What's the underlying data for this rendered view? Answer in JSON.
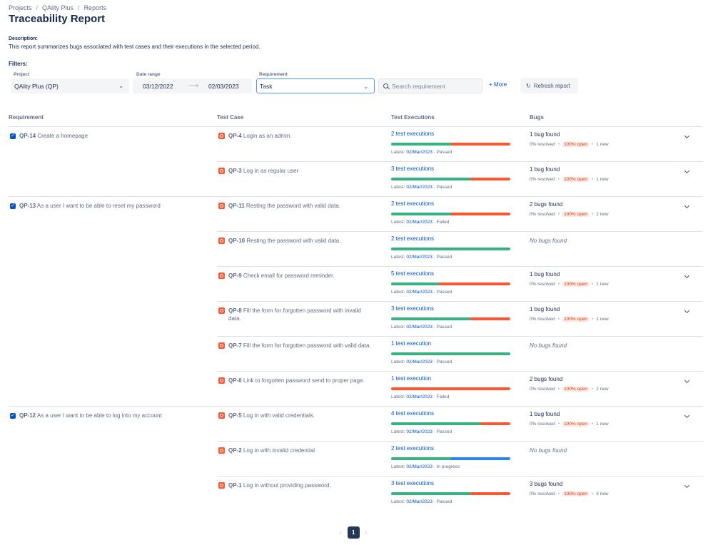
{
  "breadcrumbs": [
    "Projects",
    "QAlity Plus",
    "Reports"
  ],
  "title": "Traceability Report",
  "description_label": "Description:",
  "description": "This report summarizes bugs associated with test cases and their executions in the selected period.",
  "filters": {
    "label": "Filters:",
    "project_label": "Project",
    "project_value": "QAlity Plus (QP)",
    "date_label": "Date range",
    "date_from": "03/12/2022",
    "date_to": "02/03/2023",
    "requirement_label": "Requirement",
    "requirement_value": "Task",
    "search_placeholder": "Search requirement",
    "more_label": "More",
    "refresh_label": "Refresh report"
  },
  "columns": [
    "Requirement",
    "Test Case",
    "Test Executions",
    "Bugs"
  ],
  "colors": {
    "passed": "#36b37e",
    "failed": "#ff5630",
    "in_progress": "#2684ff"
  },
  "requirements": [
    {
      "key": "QP-14",
      "title": "Create a homepage"
    },
    {
      "key": "QP-13",
      "title": "As a user I want to be able to reset my password"
    },
    {
      "key": "QP-12",
      "title": "As a user I want to be able to log into my account"
    }
  ],
  "rows": [
    {
      "key": "QP-4",
      "title": "Login as an admin.",
      "executions": "2 test executions",
      "latest_label": "Latest:",
      "latest_date": "02/Mar/2023",
      "latest_status": "Passed",
      "bar": [
        [
          "passed",
          0.5
        ],
        [
          "failed",
          0.5
        ]
      ],
      "bugs": "1 bug found",
      "resolved": "0% resolved",
      "open": "100% open",
      "new": "1 new"
    },
    {
      "key": "QP-3",
      "title": "Log in as regular user",
      "executions": "3 test executions",
      "latest_label": "Latest:",
      "latest_date": "02/Mar/2023",
      "latest_status": "Passed",
      "bar": [
        [
          "passed",
          0.667
        ],
        [
          "failed",
          0.333
        ]
      ],
      "bugs": "1 bug found",
      "resolved": "0% resolved",
      "open": "100% open",
      "new": "1 new"
    },
    {
      "key": "QP-11",
      "title": "Resting the password with valid data.",
      "executions": "2 test executions",
      "latest_label": "Latest:",
      "latest_date": "02/Mar/2023",
      "latest_status": "Failed",
      "bar": [
        [
          "passed",
          0.5
        ],
        [
          "failed",
          0.5
        ]
      ],
      "bugs": "2 bugs found",
      "resolved": "0% resolved",
      "open": "100% open",
      "new": "2 new"
    },
    {
      "key": "QP-10",
      "title": "Resting the password with valid data.",
      "executions": "2 test executions",
      "latest_label": "Latest:",
      "latest_date": "02/Mar/2023",
      "latest_status": "Passed",
      "bar": [
        [
          "passed",
          1
        ]
      ],
      "bugs_none": "No bugs found"
    },
    {
      "key": "QP-9",
      "title": "Check email for password reminder.",
      "executions": "5 test executions",
      "latest_label": "Latest:",
      "latest_date": "02/Mar/2023",
      "latest_status": "Passed",
      "bar": [
        [
          "passed",
          0.4
        ],
        [
          "failed",
          0.6
        ]
      ],
      "bugs": "1 bug found",
      "resolved": "0% resolved",
      "open": "100% open",
      "new": "1 new"
    },
    {
      "key": "QP-8",
      "title": "Fill the form for forgotten password with invalid data.",
      "executions": "3 test executions",
      "latest_label": "Latest:",
      "latest_date": "02/Mar/2023",
      "latest_status": "Passed",
      "bar": [
        [
          "passed",
          0.667
        ],
        [
          "failed",
          0.333
        ]
      ],
      "bugs": "1 bug found",
      "resolved": "0% resolved",
      "open": "100% open",
      "new": "1 new"
    },
    {
      "key": "QP-7",
      "title": "Fill the form for forgotten password with valid data.",
      "executions": "1 test execution",
      "latest_label": "Latest:",
      "latest_date": "02/Mar/2023",
      "latest_status": "Passed",
      "bar": [
        [
          "passed",
          1
        ]
      ],
      "bugs_none": "No bugs found"
    },
    {
      "key": "QP-6",
      "title": "Link to forgotten password send to proper page.",
      "executions": "1 test execution",
      "latest_label": "Latest:",
      "latest_date": "02/Mar/2023",
      "latest_status": "Failed",
      "bar": [
        [
          "failed",
          1
        ]
      ],
      "bugs": "2 bugs found",
      "resolved": "0% resolved",
      "open": "100% open",
      "new": "2 new"
    },
    {
      "key": "QP-5",
      "title": "Log in with valid credentials.",
      "executions": "4 test executions",
      "latest_label": "Latest:",
      "latest_date": "02/Mar/2023",
      "latest_status": "Passed",
      "bar": [
        [
          "passed",
          0.75
        ],
        [
          "failed",
          0.25
        ]
      ],
      "bugs": "1 bug found",
      "resolved": "0% resolved",
      "open": "100% open",
      "new": "1 new"
    },
    {
      "key": "QP-2",
      "title": "Log in with invalid credential",
      "executions": "2 test executions",
      "latest_label": "Latest:",
      "latest_date": "02/Mar/2023",
      "latest_status": "In progress",
      "bar": [
        [
          "passed",
          0.5
        ],
        [
          "in_progress",
          0.5
        ]
      ],
      "bugs_none": "No bugs found"
    },
    {
      "key": "QP-1",
      "title": "Log in without providing password.",
      "executions": "3 test executions",
      "latest_label": "Latest:",
      "latest_date": "02/Mar/2023",
      "latest_status": "Passed",
      "bar": [
        [
          "passed",
          0.667
        ],
        [
          "failed",
          0.333
        ]
      ],
      "bugs": "3 bugs found",
      "resolved": "0% resolved",
      "open": "100% open",
      "new": "3 new"
    }
  ],
  "pagination": {
    "current": "1"
  }
}
